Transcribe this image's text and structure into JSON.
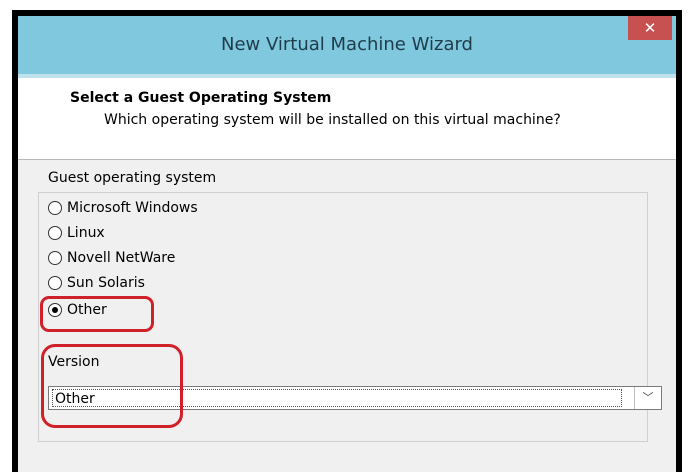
{
  "window": {
    "title": "New Virtual Machine Wizard",
    "close_glyph": "✕"
  },
  "header": {
    "title": "Select a Guest Operating System",
    "subtitle": "Which operating system will be installed on this virtual machine?"
  },
  "guest_os": {
    "legend": "Guest operating system",
    "options": [
      {
        "label": "Microsoft Windows",
        "checked": false
      },
      {
        "label": "Linux",
        "checked": false
      },
      {
        "label": "Novell NetWare",
        "checked": false
      },
      {
        "label": "Sun Solaris",
        "checked": false
      },
      {
        "label": "Other",
        "checked": true
      }
    ]
  },
  "version": {
    "label": "Version",
    "value": "Other",
    "arrow_glyph": "﹀"
  },
  "colors": {
    "titlebar": "#7fc8de",
    "close_button": "#c75050",
    "dialog_background": "#f0f0f0",
    "annotation": "#d0202a"
  }
}
